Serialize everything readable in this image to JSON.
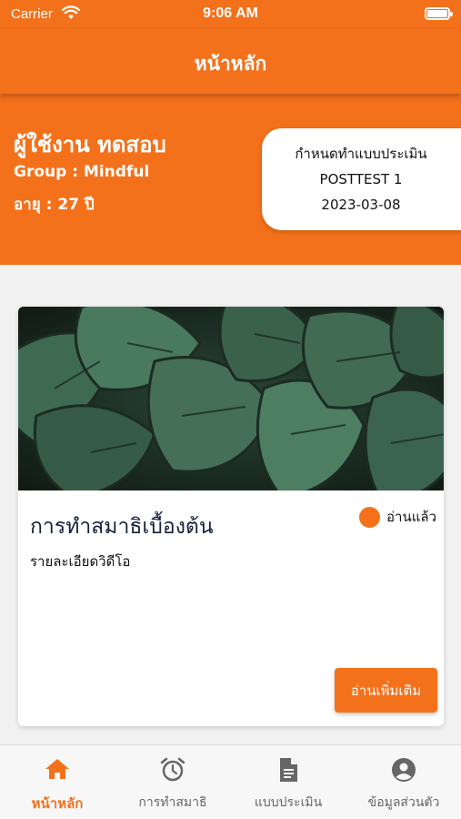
{
  "status_bar": {
    "carrier": "Carrier",
    "time": "9:06 AM"
  },
  "header": {
    "title": "หน้าหลัก"
  },
  "profile": {
    "name": "ผู้ใช้งาน ทดสอบ",
    "group": "Group : Mindful",
    "age": "อายุ : 27 ปี"
  },
  "assessment": {
    "label": "กำหนดทำแบบประเมิน",
    "name": "POSTTEST 1",
    "date": "2023-03-08"
  },
  "card": {
    "image_icon": "monstera-leaves-image",
    "title": "การทำสมาธิเบื้องต้น",
    "read_status": "อ่านแล้ว",
    "description": "รายละเอียดวิดีโอ",
    "read_more": "อ่านเพิ่มเติม"
  },
  "tabs": [
    {
      "label": "หน้าหลัก",
      "icon": "home-icon",
      "active": true
    },
    {
      "label": "การทำสมาธิ",
      "icon": "alarm-clock-icon",
      "active": false
    },
    {
      "label": "แบบประเมิน",
      "icon": "document-icon",
      "active": false
    },
    {
      "label": "ข้อมูลส่วนตัว",
      "icon": "user-circle-icon",
      "active": false
    }
  ],
  "colors": {
    "accent": "#f4711b",
    "active_tab": "#f4711b",
    "inactive_tab": "#666666"
  }
}
